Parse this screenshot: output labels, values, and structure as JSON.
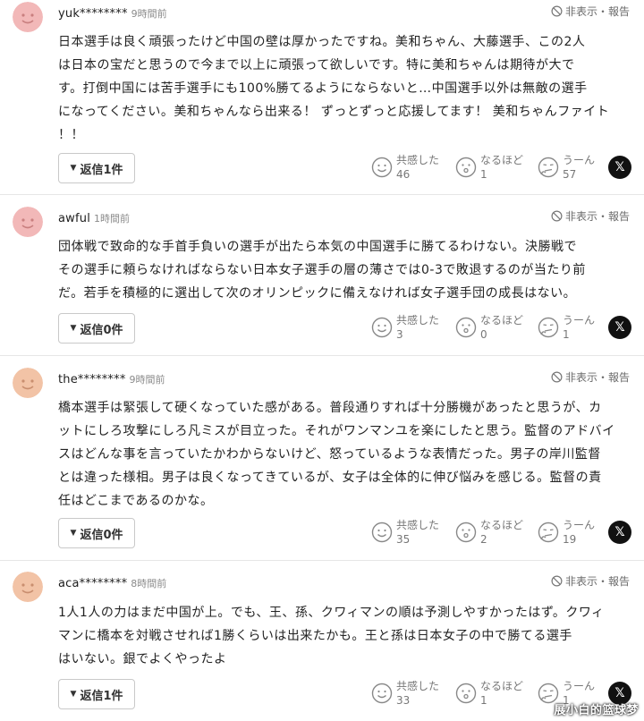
{
  "report_label": "非表示・報告",
  "reaction_labels": {
    "empathy": "共感した",
    "convinced": "なるほど",
    "hmm": "うーん"
  },
  "comments": [
    {
      "user": "yuk********",
      "time": "9時間前",
      "avatar_color": "#f2b8b8",
      "lines": [
        "日本選手は良く頑張ったけど中国の壁は厚かったですね。美和ちゃん、大藤選手、この2人",
        "は日本の宝だと思うので今まで以上に頑張って欲しいです。特に美和ちゃんは期待が大で",
        "す。打倒中国には苦手選手にも100%勝てるようにならないと…中国選手以外は無敵の選手",
        "になってください。美和ちゃんなら出来る！ ずっとずっと応援してます！ 美和ちゃんファイト",
        "！！"
      ],
      "reply": "返信1件",
      "counts": {
        "empathy": "46",
        "convinced": "1",
        "hmm": "57"
      }
    },
    {
      "user": "awful",
      "time": "1時間前",
      "avatar_color": "#f2b8b8",
      "lines": [
        "団体戦で致命的な手首手負いの選手が出たら本気の中国選手に勝てるわけない。決勝戦で",
        "その選手に頼らなければならない日本女子選手の層の薄さでは0-3で敗退するのが当たり前",
        "だ。若手を積極的に選出して次のオリンピックに備えなければ女子選手団の成長はない。"
      ],
      "reply": "返信0件",
      "counts": {
        "empathy": "3",
        "convinced": "0",
        "hmm": "1"
      }
    },
    {
      "user": "the********",
      "time": "9時間前",
      "avatar_color": "#f2c3a6",
      "lines": [
        "橋本選手は緊張して硬くなっていた感がある。普段通りすれば十分勝機があったと思うが、カ",
        "ットにしろ攻撃にしろ凡ミスが目立った。それがワンマンユを楽にしたと思う。監督のアドバイ",
        "スはどんな事を言っていたかわからないけど、怒っているような表情だった。男子の岸川監督",
        "とは違った様相。男子は良くなってきているが、女子は全体的に伸び悩みを感じる。監督の責",
        "任はどこまであるのかな。"
      ],
      "reply": "返信0件",
      "counts": {
        "empathy": "35",
        "convinced": "2",
        "hmm": "19"
      }
    },
    {
      "user": "aca********",
      "time": "8時間前",
      "avatar_color": "#f2c3a6",
      "lines": [
        "1人1人の力はまだ中国が上。でも、王、孫、クワィマンの順は予測しやすかったはず。クワィ",
        "マンに橋本を対戦させれば1勝くらいは出来たかも。王と孫は日本女子の中で勝てる選手",
        "はいない。銀でよくやったよ"
      ],
      "reply": "返信1件",
      "counts": {
        "empathy": "33",
        "convinced": "1",
        "hmm": "1"
      }
    }
  ],
  "watermark": "展小白的篮球梦"
}
